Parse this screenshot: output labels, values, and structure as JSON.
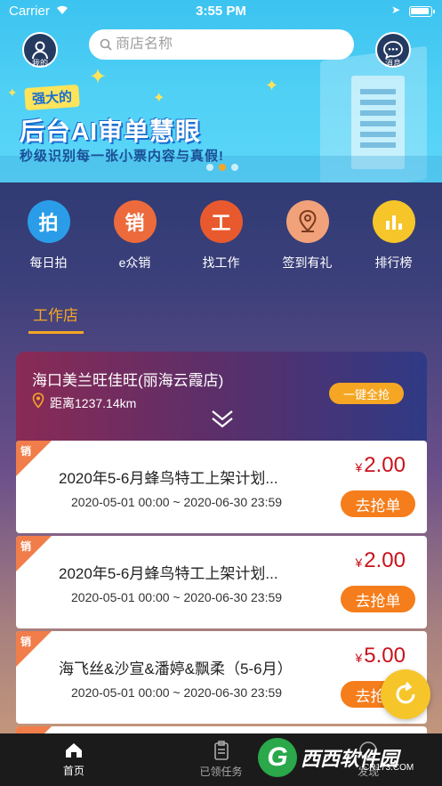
{
  "status_bar": {
    "carrier": "Carrier",
    "time": "3:55 PM"
  },
  "header": {
    "avatar_label": "我的",
    "message_label": "消息",
    "search_placeholder": "商店名称"
  },
  "banner": {
    "badge": "强大的",
    "headline": "后台AI审单慧眼",
    "subline": "秒级识别每一张小票内容与真假!",
    "dots": 3,
    "active_dot": 1
  },
  "menu": [
    {
      "icon_text": "拍",
      "label": "每日拍",
      "color": "#2b9de8",
      "icon": "camera-icon"
    },
    {
      "icon_text": "销",
      "label": "e众销",
      "color": "#ec6a3c",
      "icon": "sales-icon"
    },
    {
      "icon_text": "工",
      "label": "找工作",
      "color": "#e85a2e",
      "icon": "job-icon"
    },
    {
      "icon_text": "",
      "label": "签到有礼",
      "color": "#f1a27a",
      "icon": "location-pin-icon"
    },
    {
      "icon_text": "",
      "label": "排行榜",
      "color": "#f6c52a",
      "icon": "bar-chart-icon"
    }
  ],
  "section_tab": "工作店",
  "store": {
    "name": "海口美兰旺佳旺(丽海云霞店)",
    "distance": "距离1237.14km",
    "grab_all": "一键全抢"
  },
  "tasks": [
    {
      "corner": "销",
      "title": "2020年5-6月蜂鸟特工上架计划...",
      "dates": "2020-05-01 00:00 ~ 2020-06-30 23:59",
      "currency": "¥",
      "price": "2.00",
      "button": "去抢单"
    },
    {
      "corner": "销",
      "title": "2020年5-6月蜂鸟特工上架计划...",
      "dates": "2020-05-01 00:00 ~ 2020-06-30 23:59",
      "currency": "¥",
      "price": "2.00",
      "button": "去抢单"
    },
    {
      "corner": "销",
      "title": "海飞丝&沙宣&潘婷&飘柔（5-6月）",
      "dates": "2020-05-01 00:00 ~ 2020-06-30 23:59",
      "currency": "¥",
      "price": "5.00",
      "button": "去抢单"
    }
  ],
  "tab_bar": [
    {
      "label": "首页",
      "icon": "home-icon",
      "active": true
    },
    {
      "label": "已领任务",
      "icon": "clipboard-icon",
      "active": false
    },
    {
      "label": "发现",
      "icon": "discover-icon",
      "active": false
    }
  ],
  "watermark": {
    "letter": "G",
    "text": "西西软件园",
    "url": "CR173.COM"
  }
}
